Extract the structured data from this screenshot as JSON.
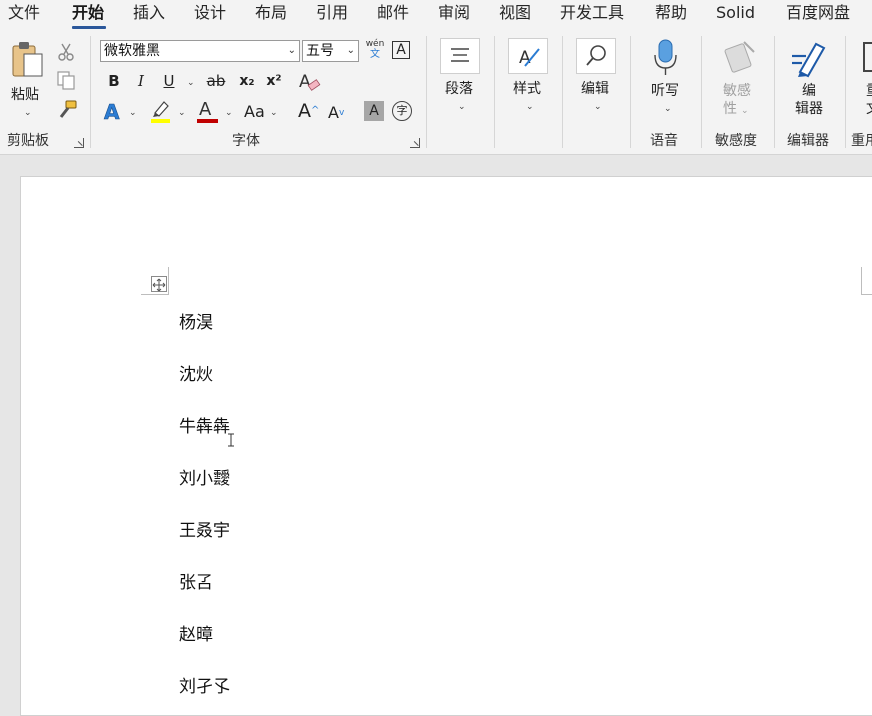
{
  "tabs": [
    {
      "label": "文件",
      "active": false
    },
    {
      "label": "开始",
      "active": true
    },
    {
      "label": "插入",
      "active": false
    },
    {
      "label": "设计",
      "active": false
    },
    {
      "label": "布局",
      "active": false
    },
    {
      "label": "引用",
      "active": false
    },
    {
      "label": "邮件",
      "active": false
    },
    {
      "label": "审阅",
      "active": false
    },
    {
      "label": "视图",
      "active": false
    },
    {
      "label": "开发工具",
      "active": false
    },
    {
      "label": "帮助",
      "active": false
    },
    {
      "label": "Solid",
      "active": false
    },
    {
      "label": "百度网盘",
      "active": false
    }
  ],
  "clipboard": {
    "paste_label": "粘贴",
    "group_label": "剪贴板"
  },
  "font": {
    "font_name": "微软雅黑",
    "font_size": "五号",
    "phonetic_top": "wén",
    "phonetic_bottom": "文",
    "bold": "B",
    "italic": "I",
    "underline": "U",
    "strike": "ab",
    "sub": "x₂",
    "sup": "x²",
    "change_case": "Aa",
    "grow": "A",
    "shrink": "A",
    "group_label": "字体",
    "colors": {
      "highlight": "#ffff00",
      "font_color": "#c00000",
      "text_effect": "#2b7cd3"
    }
  },
  "paragraph": {
    "label": "段落"
  },
  "styles": {
    "label": "样式"
  },
  "editing": {
    "label": "编辑"
  },
  "voice": {
    "button_label": "听写",
    "group_label": "语音"
  },
  "sensitivity": {
    "button_label_1": "敏感",
    "button_label_2": "性",
    "group_label": "敏感度"
  },
  "editor": {
    "button_label_1": "编",
    "button_label_2": "辑器",
    "group_label": "编辑器"
  },
  "reuse": {
    "button_label_1": "重",
    "button_label_2": "文",
    "group_label": "重用"
  },
  "document": {
    "lines": [
      "杨淏",
      "沈炏",
      "牛犇犇",
      "刘小靉",
      "王叒宇",
      "张叾",
      "赵暲",
      "刘孑孓"
    ]
  }
}
